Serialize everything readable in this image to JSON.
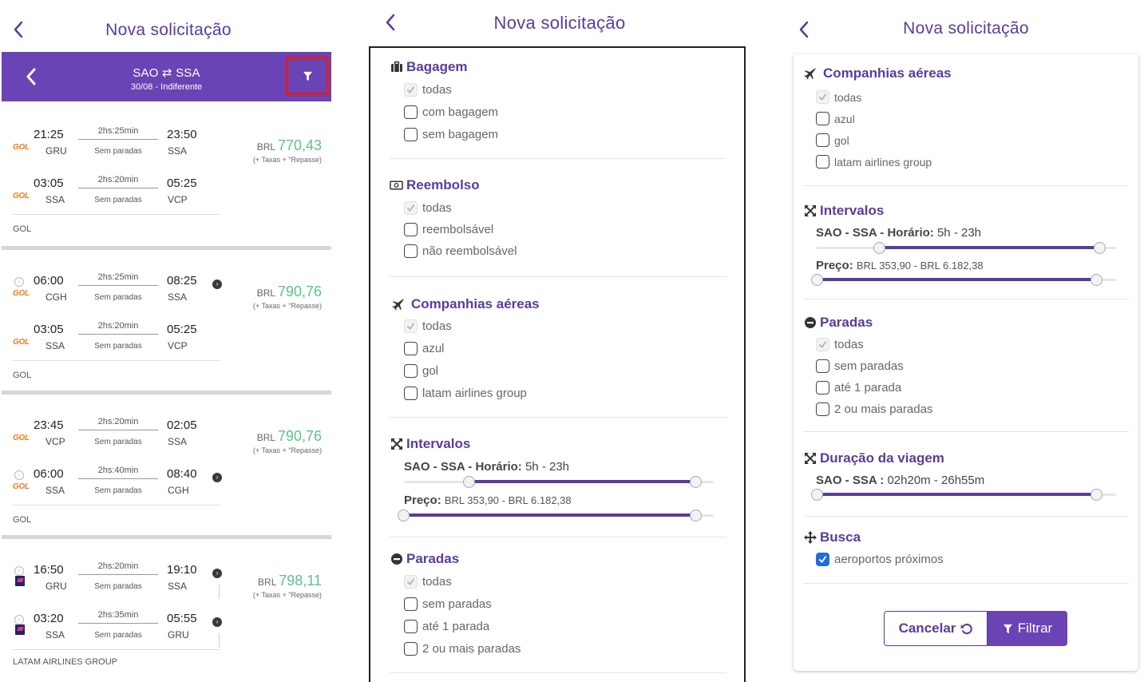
{
  "screen1": {
    "title": "Nova solicitação",
    "route": "SAO ⇄ SSA",
    "date_line": "30/08 - Indiferente",
    "cards": [
      {
        "legs": [
          {
            "dep_time": "21:25",
            "dep_ap": "GRU",
            "duration": "2hs:25min",
            "stops": "Sem paradas",
            "arr_time": "23:50",
            "arr_ap": "SSA",
            "logo": "GOL"
          },
          {
            "dep_time": "03:05",
            "dep_ap": "SSA",
            "duration": "2hs:20min",
            "stops": "Sem paradas",
            "arr_time": "05:25",
            "arr_ap": "VCP",
            "logo": "GOL"
          }
        ],
        "currency": "BRL",
        "price": "770,43",
        "tax": "(+ Taxas + \"Repasse)",
        "airline": "GOL"
      },
      {
        "legs": [
          {
            "dep_time": "06:00",
            "dep_ap": "CGH",
            "duration": "2hs:25min",
            "stops": "Sem paradas",
            "arr_time": "08:25",
            "arr_ap": "SSA",
            "logo": "GOL"
          },
          {
            "dep_time": "03:05",
            "dep_ap": "SSA",
            "duration": "2hs:20min",
            "stops": "Sem paradas",
            "arr_time": "05:25",
            "arr_ap": "VCP",
            "logo": "GOL"
          }
        ],
        "currency": "BRL",
        "price": "790,76",
        "tax": "(+ Taxas + \"Repasse)",
        "airline": "GOL"
      },
      {
        "legs": [
          {
            "dep_time": "23:45",
            "dep_ap": "VCP",
            "duration": "2hs:20min",
            "stops": "Sem paradas",
            "arr_time": "02:05",
            "arr_ap": "SSA",
            "logo": "GOL"
          },
          {
            "dep_time": "06:00",
            "dep_ap": "SSA",
            "duration": "2hs:40min",
            "stops": "Sem paradas",
            "arr_time": "08:40",
            "arr_ap": "CGH",
            "logo": "GOL"
          }
        ],
        "currency": "BRL",
        "price": "790,76",
        "tax": "(+ Taxas + \"Repasse)",
        "airline": "GOL"
      },
      {
        "legs": [
          {
            "dep_time": "16:50",
            "dep_ap": "GRU",
            "duration": "2hs:20min",
            "stops": "Sem paradas",
            "arr_time": "19:10",
            "arr_ap": "SSA",
            "logo": "LATAM"
          },
          {
            "dep_time": "03:20",
            "dep_ap": "SSA",
            "duration": "2hs:35min",
            "stops": "Sem paradas",
            "arr_time": "05:55",
            "arr_ap": "GRU",
            "logo": "LATAM"
          }
        ],
        "currency": "BRL",
        "price": "798,11",
        "tax": "(+ Taxas + \"Repasse)",
        "airline": "LATAM AIRLINES GROUP"
      }
    ]
  },
  "screen2": {
    "title": "Nova solicitação",
    "bagagem": {
      "title": "Bagagem",
      "options": [
        "todas",
        "com bagagem",
        "sem bagagem"
      ]
    },
    "reembolso": {
      "title": "Reembolso",
      "options": [
        "todas",
        "reembolsável",
        "não reembolsável"
      ]
    },
    "companhias": {
      "title": "Companhias aéreas",
      "options": [
        "todas",
        "azul",
        "gol",
        "latam airlines group"
      ]
    },
    "intervalos": {
      "title": "Intervalos",
      "horario_label": "SAO - SSA - Horário:",
      "horario_value": "5h - 23h",
      "preco_label": "Preço:",
      "preco_value": "BRL 353,90 - BRL 6.182,38"
    },
    "paradas": {
      "title": "Paradas",
      "options": [
        "todas",
        "sem paradas",
        "até 1 parada",
        "2 ou mais paradas"
      ]
    }
  },
  "screen3": {
    "title": "Nova solicitação",
    "companhias": {
      "title": "Companhias aéreas",
      "options": [
        "todas",
        "azul",
        "gol",
        "latam airlines group"
      ]
    },
    "intervalos": {
      "title": "Intervalos",
      "horario_label": "SAO - SSA - Horário:",
      "horario_value": "5h - 23h",
      "preco_label": "Preço:",
      "preco_value": "BRL 353,90 - BRL 6.182,38"
    },
    "paradas": {
      "title": "Paradas",
      "options": [
        "todas",
        "sem paradas",
        "até 1 parada",
        "2 ou mais paradas"
      ]
    },
    "duracao": {
      "title": "Duração da viagem",
      "label": "SAO - SSA :",
      "value": "02h20m - 26h55m"
    },
    "busca": {
      "title": "Busca",
      "options": [
        "aeroportos próximos"
      ]
    },
    "cancel_label": "Cancelar",
    "filter_label": "Filtrar"
  },
  "colors": {
    "brand_purple": "#6a43b4",
    "heading_purple": "#5a3c9a",
    "price_green": "#5cc38a",
    "highlight_red": "#e01b24",
    "checkbox_blue": "#1e6fd6"
  }
}
